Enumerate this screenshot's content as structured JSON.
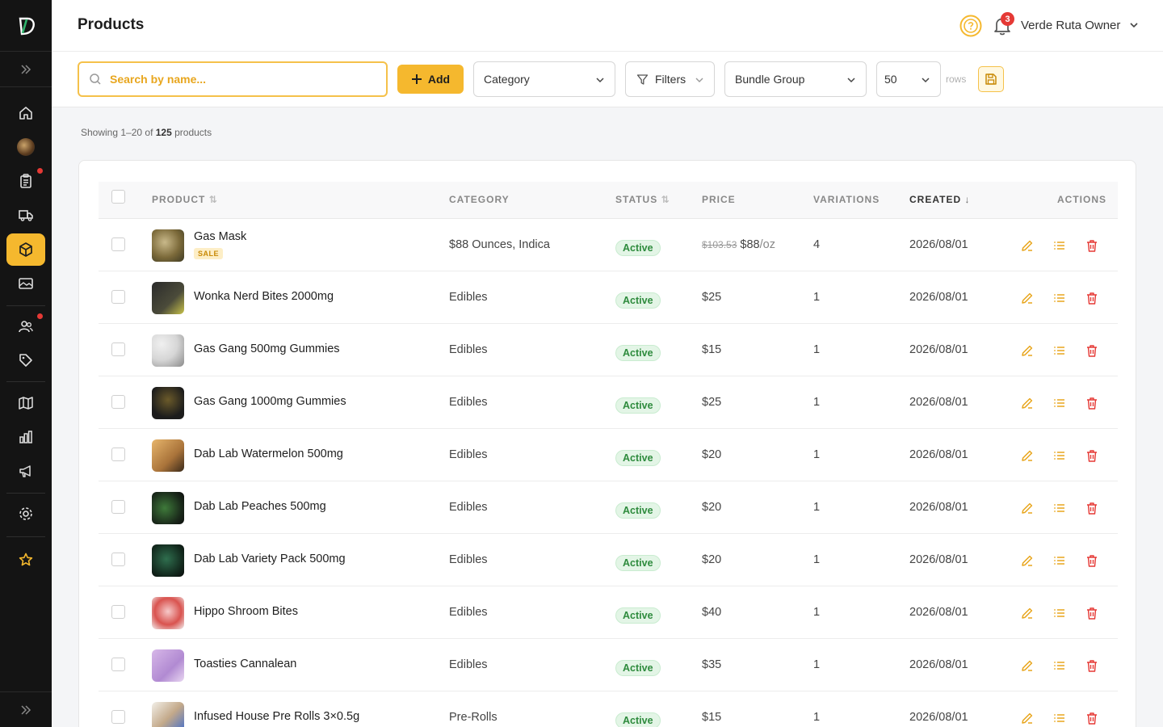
{
  "header": {
    "title": "Products",
    "notifications_count": "3",
    "user_name": "Verde Ruta Owner"
  },
  "toolbar": {
    "search_placeholder": "Search by name...",
    "add_label": "Add",
    "category_label": "Category",
    "filters_label": "Filters",
    "bundle_group_label": "Bundle Group",
    "rows_value": "50",
    "rows_label": "rows"
  },
  "summary": {
    "prefix": "Showing 1–20 of ",
    "total": "125",
    "suffix": " products"
  },
  "table": {
    "columns": {
      "product": "PRODUCT",
      "category": "CATEGORY",
      "status": "STATUS",
      "price": "PRICE",
      "variations": "VARIATIONS",
      "created": "CREATED",
      "actions": "ACTIONS"
    },
    "rows": [
      {
        "name": "Gas Mask",
        "badge": "SALE",
        "category": "$88 Ounces, Indica",
        "status": "Active",
        "old_price": "$103.53",
        "price": "$88",
        "unit": "/oz",
        "variations": "4",
        "created": "2026/08/01"
      },
      {
        "name": "Wonka Nerd Bites 2000mg",
        "badge": "",
        "category": "Edibles",
        "status": "Active",
        "old_price": "",
        "price": "$25",
        "unit": "",
        "variations": "1",
        "created": "2026/08/01"
      },
      {
        "name": "Gas Gang 500mg Gummies",
        "badge": "",
        "category": "Edibles",
        "status": "Active",
        "old_price": "",
        "price": "$15",
        "unit": "",
        "variations": "1",
        "created": "2026/08/01"
      },
      {
        "name": "Gas Gang 1000mg Gummies",
        "badge": "",
        "category": "Edibles",
        "status": "Active",
        "old_price": "",
        "price": "$25",
        "unit": "",
        "variations": "1",
        "created": "2026/08/01"
      },
      {
        "name": "Dab Lab Watermelon 500mg",
        "badge": "",
        "category": "Edibles",
        "status": "Active",
        "old_price": "",
        "price": "$20",
        "unit": "",
        "variations": "1",
        "created": "2026/08/01"
      },
      {
        "name": "Dab Lab Peaches 500mg",
        "badge": "",
        "category": "Edibles",
        "status": "Active",
        "old_price": "",
        "price": "$20",
        "unit": "",
        "variations": "1",
        "created": "2026/08/01"
      },
      {
        "name": "Dab Lab Variety Pack 500mg",
        "badge": "",
        "category": "Edibles",
        "status": "Active",
        "old_price": "",
        "price": "$20",
        "unit": "",
        "variations": "1",
        "created": "2026/08/01"
      },
      {
        "name": "Hippo Shroom Bites",
        "badge": "",
        "category": "Edibles",
        "status": "Active",
        "old_price": "",
        "price": "$40",
        "unit": "",
        "variations": "1",
        "created": "2026/08/01"
      },
      {
        "name": "Toasties Cannalean",
        "badge": "",
        "category": "Edibles",
        "status": "Active",
        "old_price": "",
        "price": "$35",
        "unit": "",
        "variations": "1",
        "created": "2026/08/01"
      },
      {
        "name": "Infused House Pre Rolls 3×0.5g",
        "badge": "",
        "category": "Pre-Rolls",
        "status": "Active",
        "old_price": "",
        "price": "$15",
        "unit": "",
        "variations": "1",
        "created": "2026/08/01"
      }
    ]
  },
  "icons": {
    "sidebar": [
      "logo-icon",
      "expand-icon",
      "home-icon",
      "avatar",
      "clipboard-icon",
      "truck-icon",
      "box-icon",
      "image-icon",
      "users-icon",
      "tag-icon",
      "map-icon",
      "chart-icon",
      "megaphone-icon",
      "gear-icon",
      "star-icon",
      "expand-icon"
    ],
    "row_actions": [
      "edit-icon",
      "list-icon",
      "trash-icon"
    ]
  },
  "colors": {
    "accent": "#f5b82e",
    "sidebar_bg": "#141414",
    "status_active": "#2e8b3d",
    "danger": "#e53935"
  }
}
